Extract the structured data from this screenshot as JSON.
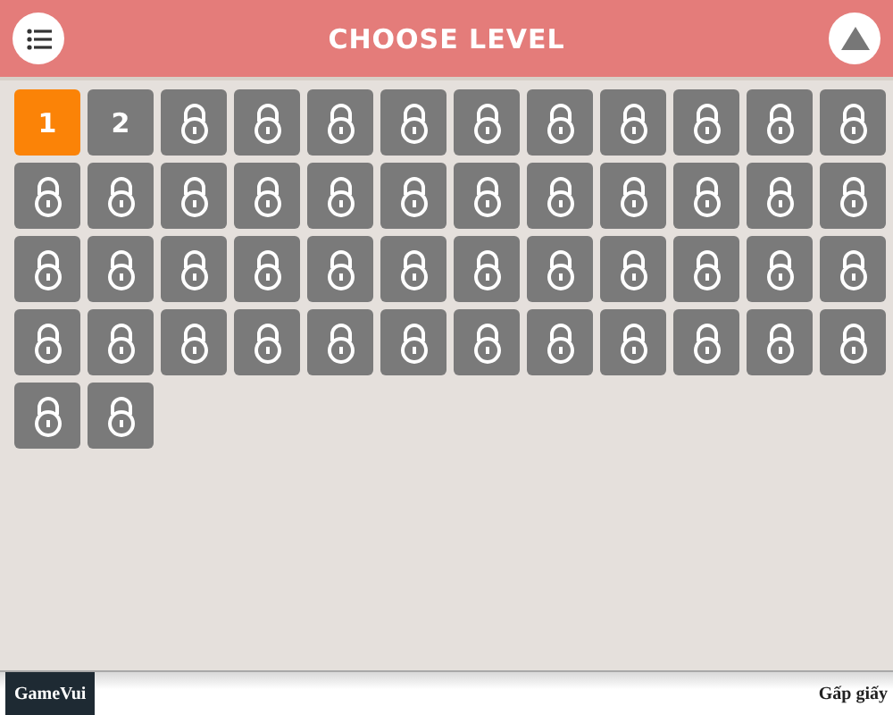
{
  "header": {
    "title": "CHOOSE LEVEL"
  },
  "levels": [
    {
      "label": "1",
      "locked": false,
      "selected": true
    },
    {
      "label": "2",
      "locked": false,
      "selected": false
    },
    {
      "locked": true,
      "selected": false
    },
    {
      "locked": true,
      "selected": false
    },
    {
      "locked": true,
      "selected": false
    },
    {
      "locked": true,
      "selected": false
    },
    {
      "locked": true,
      "selected": false
    },
    {
      "locked": true,
      "selected": false
    },
    {
      "locked": true,
      "selected": false
    },
    {
      "locked": true,
      "selected": false
    },
    {
      "locked": true,
      "selected": false
    },
    {
      "locked": true,
      "selected": false
    },
    {
      "locked": true,
      "selected": false
    },
    {
      "locked": true,
      "selected": false
    },
    {
      "locked": true,
      "selected": false
    },
    {
      "locked": true,
      "selected": false
    },
    {
      "locked": true,
      "selected": false
    },
    {
      "locked": true,
      "selected": false
    },
    {
      "locked": true,
      "selected": false
    },
    {
      "locked": true,
      "selected": false
    },
    {
      "locked": true,
      "selected": false
    },
    {
      "locked": true,
      "selected": false
    },
    {
      "locked": true,
      "selected": false
    },
    {
      "locked": true,
      "selected": false
    },
    {
      "locked": true,
      "selected": false
    },
    {
      "locked": true,
      "selected": false
    },
    {
      "locked": true,
      "selected": false
    },
    {
      "locked": true,
      "selected": false
    },
    {
      "locked": true,
      "selected": false
    },
    {
      "locked": true,
      "selected": false
    },
    {
      "locked": true,
      "selected": false
    },
    {
      "locked": true,
      "selected": false
    },
    {
      "locked": true,
      "selected": false
    },
    {
      "locked": true,
      "selected": false
    },
    {
      "locked": true,
      "selected": false
    },
    {
      "locked": true,
      "selected": false
    },
    {
      "locked": true,
      "selected": false
    },
    {
      "locked": true,
      "selected": false
    },
    {
      "locked": true,
      "selected": false
    },
    {
      "locked": true,
      "selected": false
    },
    {
      "locked": true,
      "selected": false
    },
    {
      "locked": true,
      "selected": false
    },
    {
      "locked": true,
      "selected": false
    },
    {
      "locked": true,
      "selected": false
    },
    {
      "locked": true,
      "selected": false
    },
    {
      "locked": true,
      "selected": false
    },
    {
      "locked": true,
      "selected": false
    },
    {
      "locked": true,
      "selected": false
    },
    {
      "locked": true,
      "selected": false
    },
    {
      "locked": true,
      "selected": false
    }
  ],
  "footer": {
    "brand": "GameVui",
    "game_title": "Gấp giấy"
  }
}
